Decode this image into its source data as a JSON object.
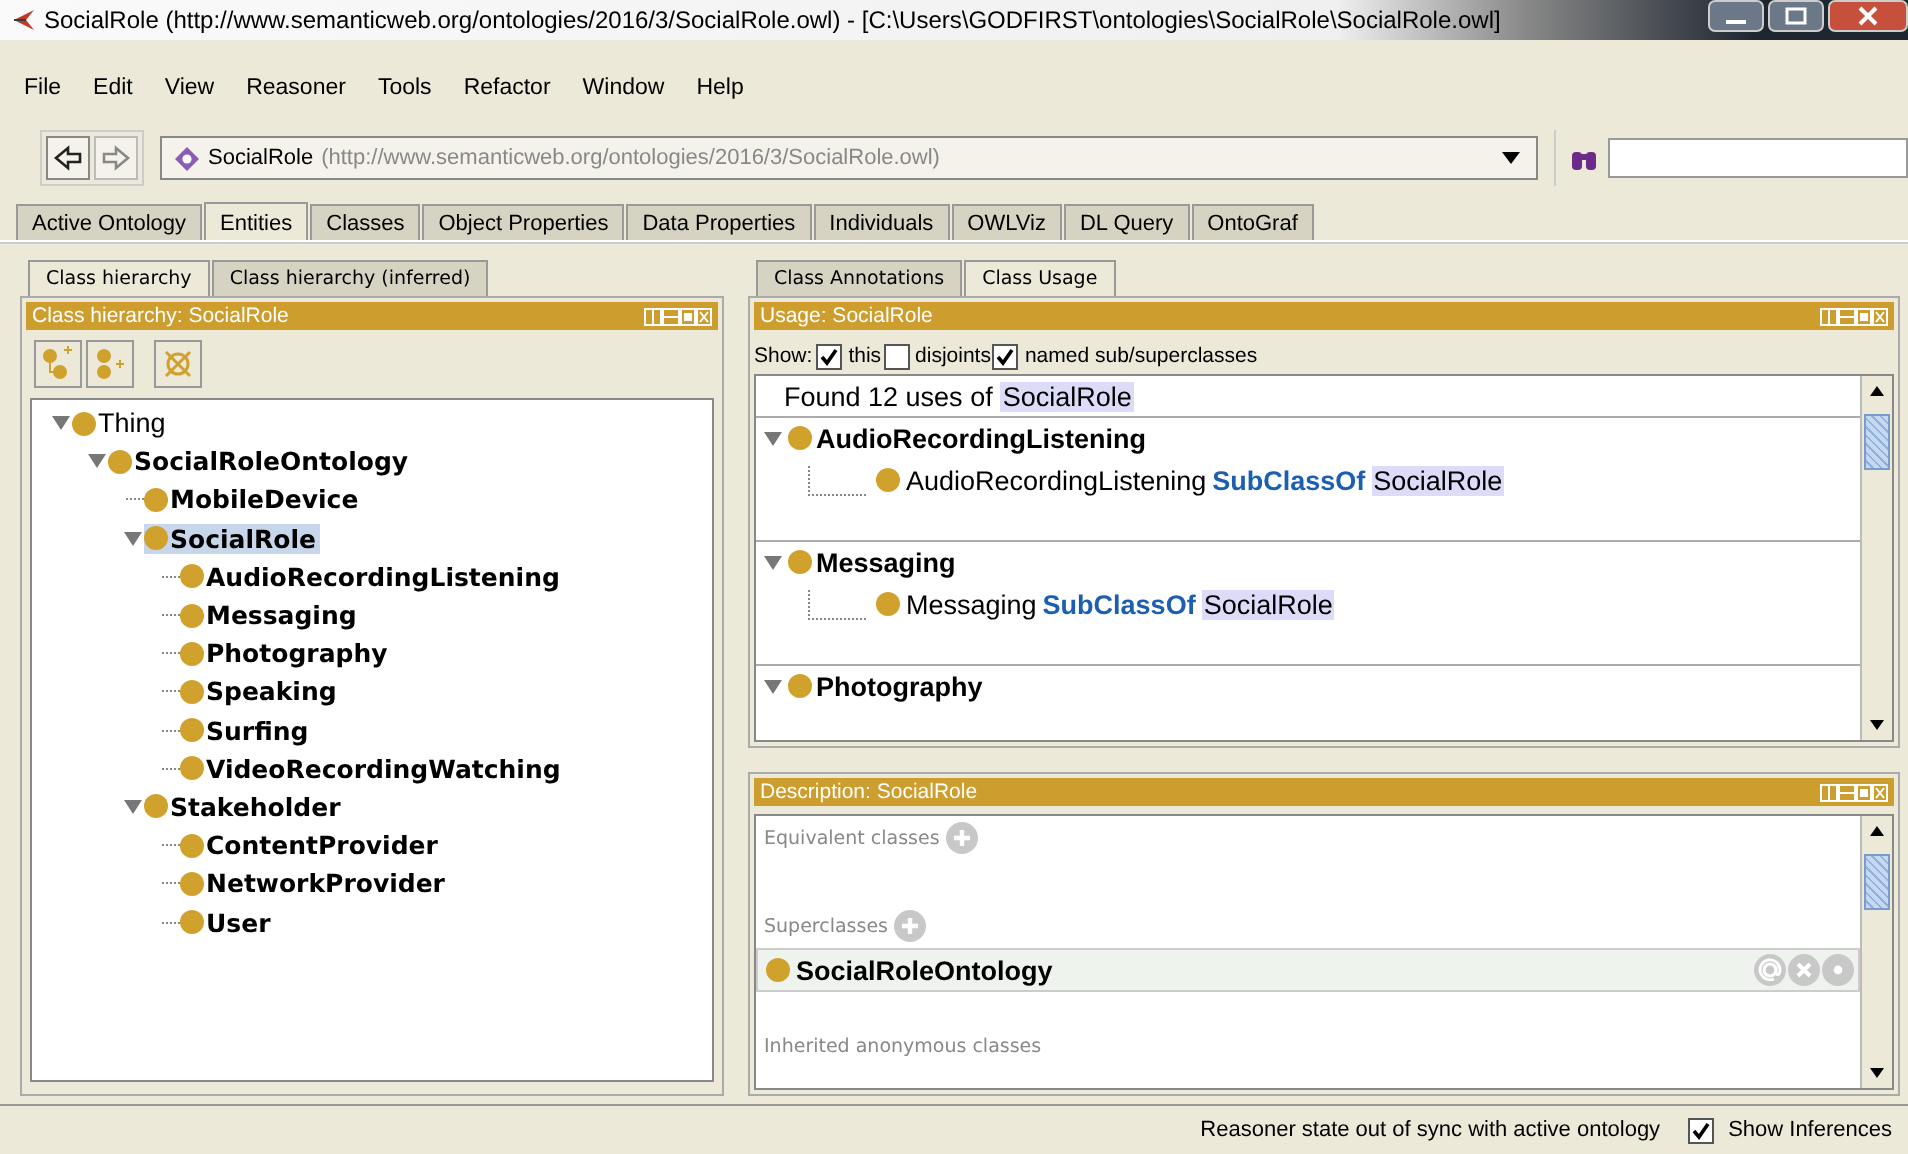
{
  "window": {
    "title": "SocialRole (http://www.semanticweb.org/ontologies/2016/3/SocialRole.owl) - [C:\\Users\\GODFIRST\\ontologies\\SocialRole\\SocialRole.owl]"
  },
  "menu": [
    "File",
    "Edit",
    "View",
    "Reasoner",
    "Tools",
    "Refactor",
    "Window",
    "Help"
  ],
  "nav": {
    "ontology_name": "SocialRole",
    "ontology_iri": "(http://www.semanticweb.org/ontologies/2016/3/SocialRole.owl)"
  },
  "main_tabs": [
    {
      "label": "Active Ontology",
      "selected": false
    },
    {
      "label": "Entities",
      "selected": true
    },
    {
      "label": "Classes",
      "selected": false
    },
    {
      "label": "Object Properties",
      "selected": false
    },
    {
      "label": "Data Properties",
      "selected": false
    },
    {
      "label": "Individuals",
      "selected": false
    },
    {
      "label": "OWLViz",
      "selected": false
    },
    {
      "label": "DL Query",
      "selected": false
    },
    {
      "label": "OntoGraf",
      "selected": false
    }
  ],
  "left_panel": {
    "tabs": [
      {
        "label": "Class hierarchy",
        "selected": true
      },
      {
        "label": "Class hierarchy (inferred)",
        "selected": false
      }
    ],
    "header": "Class hierarchy: SocialRole",
    "tree": [
      {
        "label": "Thing",
        "bold": false,
        "expanded": true,
        "selected": false,
        "children": [
          {
            "label": "SocialRoleOntology",
            "bold": true,
            "expanded": true,
            "selected": false,
            "children": [
              {
                "label": "MobileDevice",
                "bold": true,
                "selected": false
              },
              {
                "label": "SocialRole",
                "bold": true,
                "expanded": true,
                "selected": true,
                "children": [
                  {
                    "label": "AudioRecordingListening",
                    "bold": true,
                    "selected": false
                  },
                  {
                    "label": "Messaging",
                    "bold": true,
                    "selected": false
                  },
                  {
                    "label": "Photography",
                    "bold": true,
                    "selected": false
                  },
                  {
                    "label": "Speaking",
                    "bold": true,
                    "selected": false
                  },
                  {
                    "label": "Surfing",
                    "bold": true,
                    "selected": false
                  },
                  {
                    "label": "VideoRecordingWatching",
                    "bold": true,
                    "selected": false
                  }
                ]
              },
              {
                "label": "Stakeholder",
                "bold": true,
                "expanded": true,
                "selected": false,
                "children": [
                  {
                    "label": "ContentProvider",
                    "bold": true,
                    "selected": false
                  },
                  {
                    "label": "NetworkProvider",
                    "bold": true,
                    "selected": false
                  },
                  {
                    "label": "User",
                    "bold": true,
                    "selected": false
                  }
                ]
              }
            ]
          }
        ]
      }
    ]
  },
  "usage_panel": {
    "tabs": [
      {
        "label": "Class Annotations",
        "selected": false
      },
      {
        "label": "Class Usage",
        "selected": true
      }
    ],
    "header": "Usage: SocialRole",
    "show_label": "Show:",
    "options": [
      {
        "label": "this",
        "checked": true
      },
      {
        "label": "disjoints",
        "checked": false
      },
      {
        "label": "named sub/superclasses",
        "checked": true
      }
    ],
    "found": {
      "prefix": "Found 12 uses of",
      "entity": "SocialRole"
    },
    "groups": [
      {
        "name": "AudioRecordingListening",
        "expanded": true,
        "entries": [
          {
            "subject": "AudioRecordingListening",
            "keyword": "SubClassOf",
            "object": "SocialRole"
          }
        ]
      },
      {
        "name": "Messaging",
        "expanded": true,
        "entries": [
          {
            "subject": "Messaging",
            "keyword": "SubClassOf",
            "object": "SocialRole"
          }
        ]
      },
      {
        "name": "Photography",
        "expanded": true
      }
    ]
  },
  "description_panel": {
    "header": "Description: SocialRole",
    "sections": [
      {
        "title": "Equivalent classes",
        "kind": "asserted"
      },
      {
        "title": "Superclasses",
        "kind": "asserted",
        "items": [
          {
            "name": "SocialRoleOntology"
          }
        ]
      },
      {
        "title": "Inherited anonymous classes",
        "kind": "inherited"
      }
    ]
  },
  "status_bar": {
    "message": "Reasoner state out of sync with active ontology",
    "show_inferences": {
      "label": "Show Inferences",
      "checked": true
    }
  }
}
